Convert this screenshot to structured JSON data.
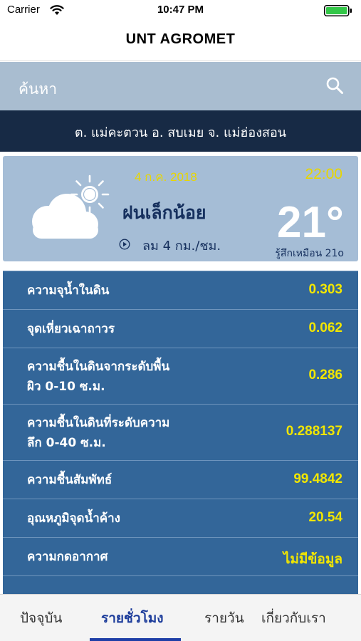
{
  "status_bar": {
    "carrier": "Carrier",
    "time": "10:47 PM"
  },
  "app": {
    "title": "UNT AGROMET"
  },
  "search": {
    "placeholder": "ค้นหา"
  },
  "location": {
    "text": "ต. แม่คะตวน อ. สบเมย จ. แม่ฮ่องสอน"
  },
  "weather": {
    "date": "4 ก.ค. 2018",
    "time": "22:00",
    "condition": "ฝนเล็กน้อย",
    "wind": "ลม 4 กม./ชม.",
    "temperature": "21°",
    "feels_like": "รู้สึกเหมือน 21o",
    "icon": "partly-cloudy-icon"
  },
  "data_rows": [
    {
      "label": "ความจุน้ำในดิน",
      "value": "0.303"
    },
    {
      "label": "จุดเหี่ยวเฉาถาวร",
      "value": "0.062"
    },
    {
      "label": "ความชื้นในดินจากระดับพื้น",
      "label2": "ผิว 0-10 ซ.ม.",
      "value": "0.286"
    },
    {
      "label": "ความชื้นในดินที่ระดับความ",
      "label2": "ลึก 0-40 ซ.ม.",
      "value": "0.288137"
    },
    {
      "label": "ความชื้นสัมพัทธ์",
      "value": "99.4842"
    },
    {
      "label": "อุณหภูมิจุดน้ำค้าง",
      "value": "20.54"
    },
    {
      "label": "ความกดอากาศ",
      "value": "ไม่มีข้อมูล"
    }
  ],
  "tabs": [
    {
      "label": "ปัจจุบัน",
      "active": false
    },
    {
      "label": "รายชั่วโมง",
      "active": true
    },
    {
      "label": "รายวัน",
      "active": false
    },
    {
      "label": "เกี่ยวกับเรา",
      "active": false
    }
  ],
  "colors": {
    "accent_yellow": "#f2e600",
    "data_row_bg": "#336699",
    "location_bg": "#172a45",
    "search_bg": "#a9bdd0",
    "active_tab": "#1b3b9a"
  }
}
